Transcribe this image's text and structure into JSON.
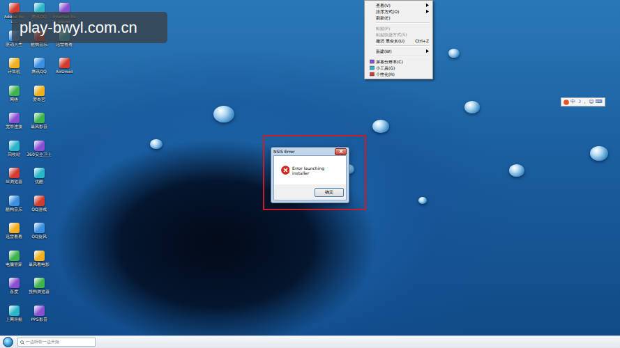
{
  "watermark": "play-bwyl.com.cn",
  "desktop": {
    "columns": [
      [
        {
          "label": "Adobe Rea..."
        },
        {
          "label": "驱动人生"
        },
        {
          "label": "计算机"
        },
        {
          "label": "网络"
        },
        {
          "label": "宽带连接"
        },
        {
          "label": "回收站"
        },
        {
          "label": "IE浏览器"
        },
        {
          "label": "酷狗音乐"
        },
        {
          "label": "迅雷看看"
        },
        {
          "label": "电脑管家"
        },
        {
          "label": "百度"
        },
        {
          "label": "上网导航"
        }
      ],
      [
        {
          "label": "腾讯QQ"
        },
        {
          "label": "酷我音乐"
        },
        {
          "label": "腾讯QQ"
        },
        {
          "label": "爱奇艺"
        },
        {
          "label": "暴风影音"
        },
        {
          "label": "360安全卫士"
        },
        {
          "label": "优酷"
        },
        {
          "label": "QQ游戏"
        },
        {
          "label": "QQ旋风"
        },
        {
          "label": "暴风看电影"
        },
        {
          "label": "搜狗浏览器"
        },
        {
          "label": "PPS影音"
        }
      ],
      [
        {
          "label": "Internet Explorer"
        },
        {
          "label": "迅雷看看"
        },
        {
          "label": "AirDroid"
        }
      ]
    ]
  },
  "context_menu": {
    "items": [
      {
        "kind": "submenu",
        "label": "查看(V)",
        "disabled": false
      },
      {
        "kind": "submenu",
        "label": "排序方式(O)",
        "disabled": false
      },
      {
        "kind": "item",
        "label": "刷新(E)",
        "disabled": false
      },
      {
        "kind": "separator"
      },
      {
        "kind": "item",
        "label": "粘贴(P)",
        "disabled": true
      },
      {
        "kind": "item",
        "label": "粘贴快捷方式(S)",
        "disabled": true
      },
      {
        "kind": "shortcut",
        "label": "撤消 重命名(U)",
        "shortcut": "Ctrl+Z",
        "disabled": false
      },
      {
        "kind": "separator"
      },
      {
        "kind": "submenu",
        "label": "新建(W)",
        "disabled": false
      },
      {
        "kind": "separator"
      },
      {
        "kind": "item",
        "label": "屏幕分辨率(C)",
        "disabled": false
      },
      {
        "kind": "item",
        "label": "小工具(G)",
        "disabled": false
      },
      {
        "kind": "item",
        "label": "个性化(R)",
        "disabled": false
      }
    ]
  },
  "dialog": {
    "title": "NSIS Error",
    "message": "Error launching installer",
    "button": "确定"
  },
  "language_bar": {
    "items": [
      "中",
      "☽",
      "，",
      "☺",
      "⌨"
    ]
  },
  "taskbar": {
    "search_placeholder": "一边听歌一边开始"
  }
}
